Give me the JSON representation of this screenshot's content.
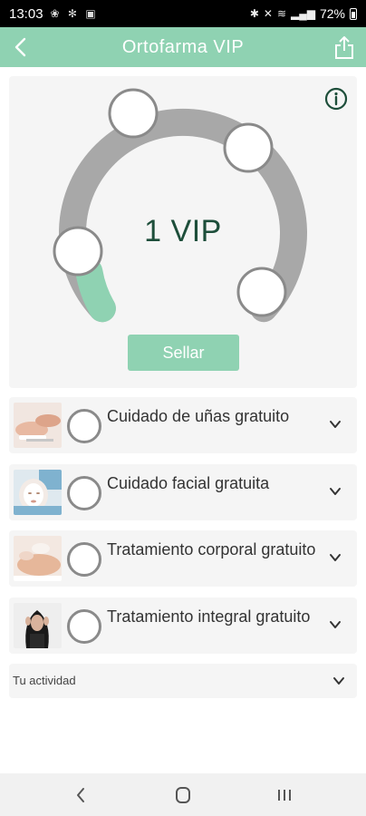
{
  "status_bar": {
    "time": "13:03",
    "battery": "72%",
    "notification_glyphs": "❀ ✻ ▣"
  },
  "header": {
    "title": "Ortofarma VIP"
  },
  "card": {
    "stamp_count": "1 VIP",
    "seal_button": "Sellar",
    "stamps_total": 5,
    "stamps_filled": 1
  },
  "rewards": [
    {
      "label": "Cuidado de uñas gratuito",
      "icon": "nail-care-photo"
    },
    {
      "label": "Cuidado facial gratuita",
      "icon": "facial-care-photo"
    },
    {
      "label": "Tratamiento corporal gratuito",
      "icon": "body-treatment-photo"
    },
    {
      "label": "Tratamiento integral gratuito",
      "icon": "integral-treatment-photo"
    }
  ],
  "activity": {
    "label": "Tu actividad"
  },
  "colors": {
    "accent": "#8fd2b2",
    "dark_text": "#1d4e3a",
    "arc": "#a8a8a8",
    "card_bg": "#f5f5f5"
  }
}
